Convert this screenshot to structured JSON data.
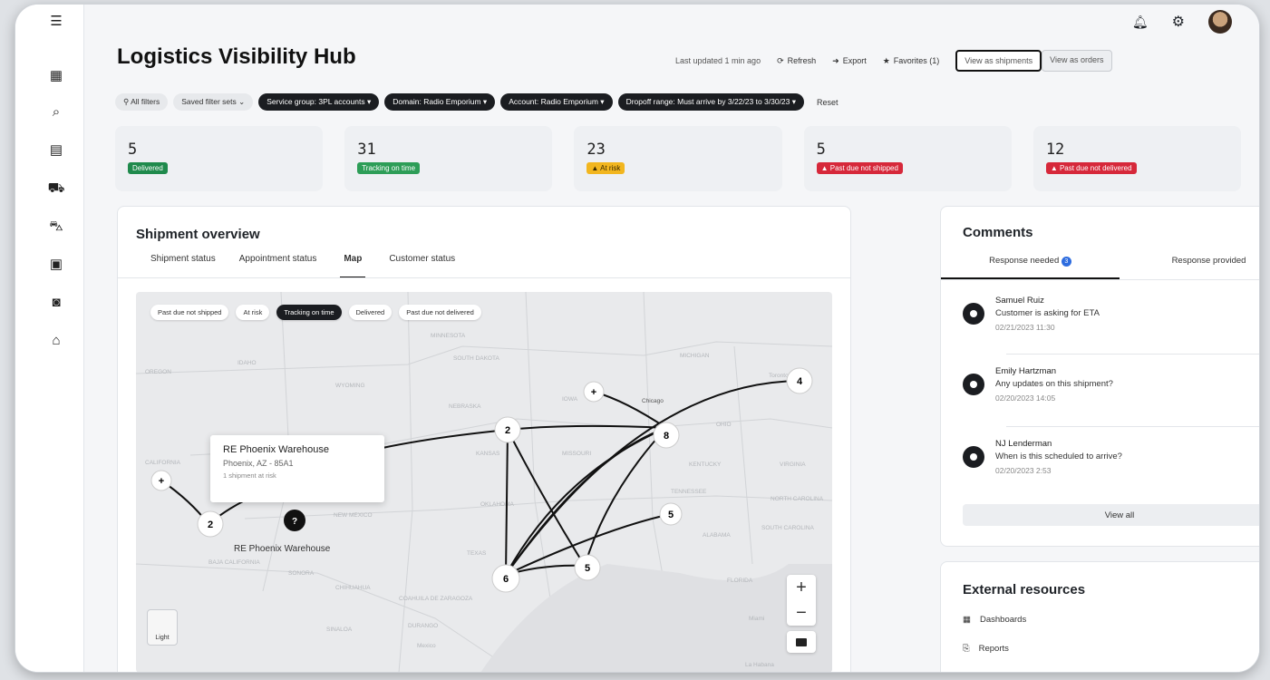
{
  "app": {
    "title": "Logistics Visibility Hub",
    "last_updated": "Last updated 1 min ago",
    "refresh_label": "Refresh",
    "export_label": "Export",
    "favorites_label": "Favorites (1)",
    "view_shipments_label": "View as shipments",
    "view_locations_label": "View as orders"
  },
  "rail": {
    "icons": [
      "menu-icon",
      "dashboard-icon",
      "search-icon",
      "list-icon",
      "cart-icon",
      "truck-icon",
      "bus-icon",
      "car-icon",
      "bank-icon"
    ]
  },
  "filters": {
    "all_filters": "All filters",
    "saved_sets": "Saved filter sets",
    "chips": [
      "Service group: 3PL accounts",
      "Domain: Radio Emporium",
      "Account: Radio Emporium",
      "Dropoff range: Must arrive by 3/22/23 to 3/30/23"
    ],
    "reset": "Reset"
  },
  "kpis": [
    {
      "value": "5",
      "label": "Delivered",
      "status": "green"
    },
    {
      "value": "31",
      "label": "Tracking on time",
      "status": "green"
    },
    {
      "value": "23",
      "label": "At risk",
      "status": "yellow"
    },
    {
      "value": "5",
      "label": "Past due not shipped",
      "status": "red"
    },
    {
      "value": "12",
      "label": "Past due not delivered",
      "status": "red"
    }
  ],
  "overview": {
    "title": "Shipment overview",
    "tabs": [
      "Shipment status",
      "Appointment status",
      "Map",
      "Customer status"
    ],
    "active_tab": "Map",
    "map_chips": [
      "Past due not shipped",
      "At risk",
      "Tracking on time",
      "Delivered",
      "Past due not delivered"
    ],
    "selected_chip": "Tracking on time",
    "tooltip": {
      "title": "RE Phoenix Warehouse",
      "address": "Phoenix, AZ - 85A1",
      "detail": "1 shipment at risk"
    },
    "marker_label": "RE Phoenix Warehouse",
    "light_label": "Light",
    "zoom_in": "+",
    "zoom_out": "−",
    "places": [
      "MINNESOTA",
      "SOUTH DAKOTA",
      "WYOMING",
      "NEBRASKA",
      "IOWA",
      "KANSAS",
      "MISSOURI",
      "OKLAHOMA",
      "TEXAS",
      "ALABAMA",
      "TENNESSEE",
      "KENTUCKY",
      "OHIO",
      "VIRGINIA",
      "NORTH CAROLINA",
      "SOUTH CAROLINA",
      "MICHIGAN",
      "Chicago",
      "CALIFORNIA",
      "NEW MEXICO",
      "SONORA",
      "CHIHUAHUA",
      "COAHUILA DE ZARAGOZA",
      "SINALOA",
      "DURANGO",
      "Mexico",
      "OREGON",
      "IDAHO",
      "Miami",
      "FLORIDA",
      "La Habana",
      "BAJA CALIFORNIA",
      "Toronto"
    ],
    "nodes": [
      {
        "label": "4"
      },
      {
        "label": "2"
      },
      {
        "label": "8"
      },
      {
        "label": "5"
      },
      {
        "label": "6"
      },
      {
        "label": "5"
      },
      {
        "label": "2"
      },
      {
        "label": "+"
      },
      {
        "label": "+"
      }
    ]
  },
  "comments": {
    "title": "Comments",
    "tabs": [
      "Response needed",
      "Response provided"
    ],
    "badge": "3",
    "items": [
      {
        "name": "Samuel Ruiz",
        "message": "Customer is asking for ETA",
        "time": "02/21/2023 11:30"
      },
      {
        "name": "Emily Hartzman",
        "message": "Any updates on this shipment?",
        "time": "02/20/2023 14:05"
      },
      {
        "name": "NJ Lenderman",
        "message": "When is this scheduled to arrive?",
        "time": "02/20/2023 2:53"
      }
    ],
    "view_all": "View all"
  },
  "external": {
    "title": "External resources",
    "items": [
      "Dashboards",
      "Reports"
    ]
  },
  "colors": {
    "delivered": "#1f8a4c",
    "at_risk": "#f2b61f",
    "past_due": "#d6283a",
    "comment_badge": "#2d6cdf"
  }
}
